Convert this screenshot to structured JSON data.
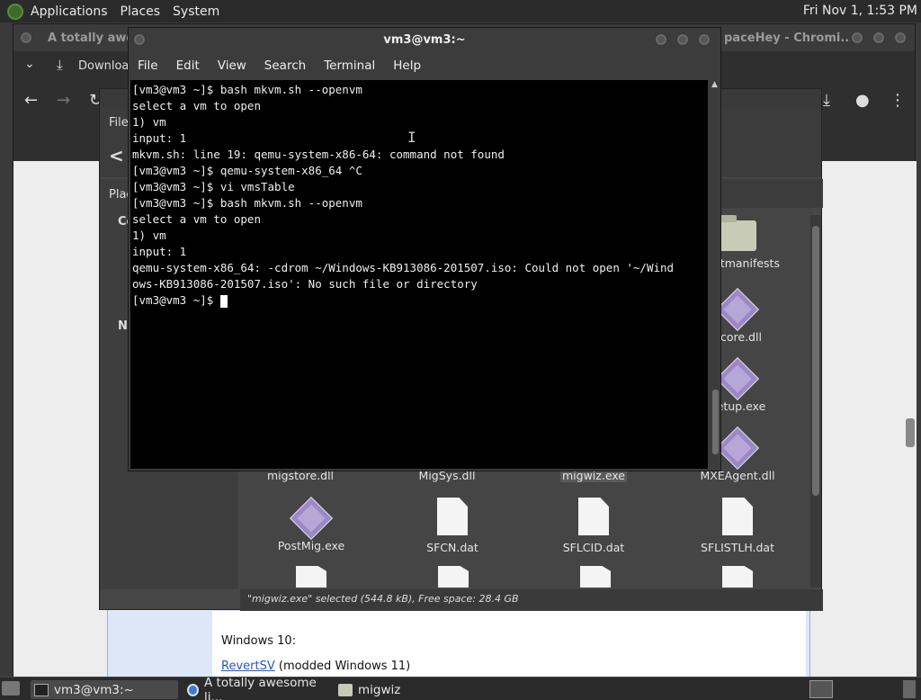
{
  "top_panel": {
    "menus": [
      "Applications",
      "Places",
      "System"
    ],
    "clock": "Fri Nov 1, 1:53 PM"
  },
  "chrome": {
    "title_left": "A totally awesome",
    "title_right": "paceHey - Chromi...",
    "tab_label": "Download",
    "page": {
      "heading": "Windows 10:",
      "link": "RevertSV",
      "link_suffix": " (modded Windows 11)"
    }
  },
  "file_manager": {
    "menu_partial": "File",
    "side_places": "Plac",
    "side_c": "Co",
    "side_n": "N",
    "status": "\"migwiz.exe\" selected (544.8 kB), Free space: 28.4 GB",
    "items": [
      {
        "name": "mentmanifests",
        "kind": "folder"
      },
      {
        "name": "gcore.dll",
        "kind": "dll"
      },
      {
        "name": "Setup.exe",
        "kind": "dll"
      },
      {
        "name": "migstore.dll",
        "kind": "dll"
      },
      {
        "name": "MigSys.dll",
        "kind": "dll"
      },
      {
        "name": "migwiz.exe",
        "kind": "dll",
        "selected": true
      },
      {
        "name": "MXEAgent.dll",
        "kind": "dll"
      },
      {
        "name": "PostMig.exe",
        "kind": "dll"
      },
      {
        "name": "SFCN.dat",
        "kind": "file"
      },
      {
        "name": "SFLCID.dat",
        "kind": "file"
      },
      {
        "name": "SFLISTLH.dat",
        "kind": "file"
      }
    ]
  },
  "terminal": {
    "title": "vm3@vm3:~",
    "menus": [
      "File",
      "Edit",
      "View",
      "Search",
      "Terminal",
      "Help"
    ],
    "lines": [
      "[vm3@vm3 ~]$ bash mkvm.sh --openvm",
      "select a vm to open",
      "1) vm",
      "input: 1",
      "mkvm.sh: line 19: qemu-system-x86-64: command not found",
      "[vm3@vm3 ~]$ qemu-system-x86_64 ^C",
      "[vm3@vm3 ~]$ vi vmsTable",
      "[vm3@vm3 ~]$ bash mkvm.sh --openvm",
      "select a vm to open",
      "1) vm",
      "input: 1",
      "qemu-system-x86_64: -cdrom ~/Windows-KB913086-201507.iso: Could not open '~/Wind",
      "ows-KB913086-201507.iso': No such file or directory",
      "[vm3@vm3 ~]$ "
    ]
  },
  "taskbar": {
    "tasks": [
      "vm3@vm3:~",
      "A totally awesome li...",
      "migwiz"
    ]
  }
}
